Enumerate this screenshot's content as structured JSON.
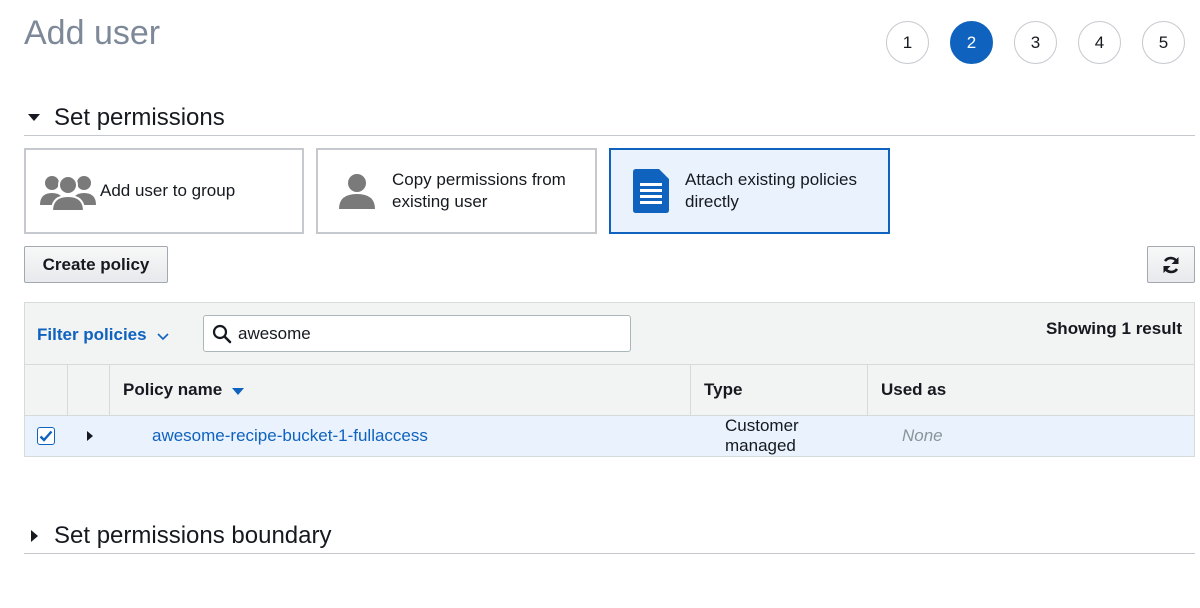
{
  "header": {
    "title": "Add user"
  },
  "steps": [
    {
      "label": "1",
      "active": false
    },
    {
      "label": "2",
      "active": true
    },
    {
      "label": "3",
      "active": false
    },
    {
      "label": "4",
      "active": false
    },
    {
      "label": "5",
      "active": false
    }
  ],
  "permissions": {
    "title": "Set permissions",
    "options": [
      {
        "label": "Add user to group",
        "icon": "user-group-icon",
        "selected": false
      },
      {
        "label": "Copy permissions from existing user",
        "icon": "user-icon",
        "selected": false
      },
      {
        "label": "Attach existing policies directly",
        "icon": "document-icon",
        "selected": true
      }
    ]
  },
  "toolbar": {
    "create_label": "Create policy",
    "refresh_icon": "refresh-icon"
  },
  "filter": {
    "dropdown_label": "Filter policies",
    "search_value": "awesome",
    "result_count": "Showing 1 result"
  },
  "table": {
    "columns": [
      "Policy name",
      "Type",
      "Used as"
    ],
    "rows": [
      {
        "checked": true,
        "name": "awesome-recipe-bucket-1-fullaccess",
        "type": "Customer managed",
        "used_as": "None"
      }
    ]
  },
  "boundary": {
    "title": "Set permissions boundary"
  },
  "colors": {
    "accent": "#0f62be",
    "selected_bg": "#eaf3fd",
    "title_gray": "#7d8998",
    "border": "#c5c9ce"
  }
}
